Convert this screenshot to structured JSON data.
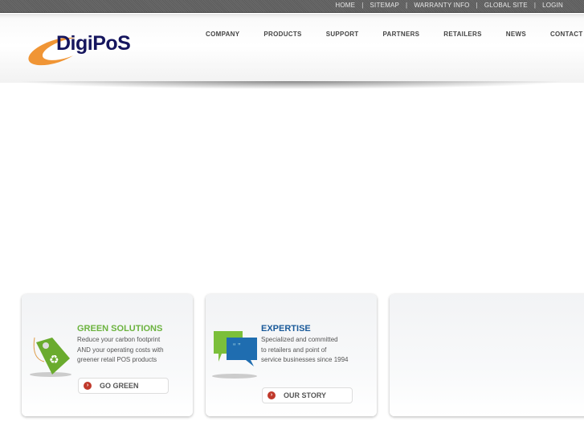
{
  "top_links": [
    "HOME",
    "SITEMAP",
    "WARRANTY INFO",
    "GLOBAL SITE",
    "LOGIN"
  ],
  "logo": "DigiPoS",
  "nav": [
    "COMPANY",
    "PRODUCTS",
    "SUPPORT",
    "PARTNERS",
    "RETAILERS",
    "NEWS",
    "CONTACT"
  ],
  "cards": [
    {
      "title": "GREEN SOLUTIONS",
      "lines": [
        "Reduce your carbon footprint",
        "AND your operating costs with",
        "greener retail POS products"
      ],
      "button": "GO GREEN",
      "color": "#6cb33f"
    },
    {
      "title": "EXPERTISE",
      "lines": [
        "Specialized and committed",
        "to retailers and point of",
        "service businesses since 1994"
      ],
      "button": "OUR STORY",
      "color": "#1a5a9a"
    }
  ]
}
